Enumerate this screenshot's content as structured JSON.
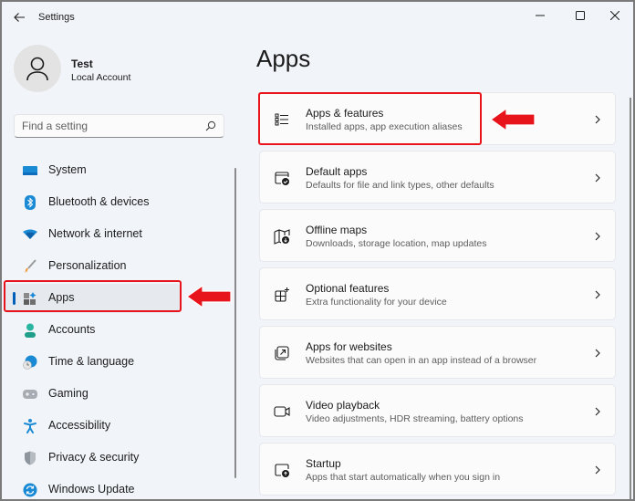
{
  "window": {
    "title": "Settings"
  },
  "profile": {
    "name": "Test",
    "account_type": "Local Account"
  },
  "search": {
    "placeholder": "Find a setting",
    "value": ""
  },
  "sidebar": {
    "selected": "Apps",
    "items": [
      {
        "label": "System",
        "icon": "system-icon"
      },
      {
        "label": "Bluetooth & devices",
        "icon": "bluetooth-icon"
      },
      {
        "label": "Network & internet",
        "icon": "wifi-icon"
      },
      {
        "label": "Personalization",
        "icon": "brush-icon"
      },
      {
        "label": "Apps",
        "icon": "apps-icon"
      },
      {
        "label": "Accounts",
        "icon": "person-icon"
      },
      {
        "label": "Time & language",
        "icon": "globe-clock-icon"
      },
      {
        "label": "Gaming",
        "icon": "gamepad-icon"
      },
      {
        "label": "Accessibility",
        "icon": "accessibility-icon"
      },
      {
        "label": "Privacy & security",
        "icon": "shield-icon"
      },
      {
        "label": "Windows Update",
        "icon": "update-icon"
      }
    ]
  },
  "main": {
    "title": "Apps",
    "cards": [
      {
        "title": "Apps & features",
        "subtitle": "Installed apps, app execution aliases",
        "icon": "list-icon"
      },
      {
        "title": "Default apps",
        "subtitle": "Defaults for file and link types, other defaults",
        "icon": "default-apps-icon"
      },
      {
        "title": "Offline maps",
        "subtitle": "Downloads, storage location, map updates",
        "icon": "map-download-icon"
      },
      {
        "title": "Optional features",
        "subtitle": "Extra functionality for your device",
        "icon": "add-grid-icon"
      },
      {
        "title": "Apps for websites",
        "subtitle": "Websites that can open in an app instead of a browser",
        "icon": "open-external-icon"
      },
      {
        "title": "Video playback",
        "subtitle": "Video adjustments, HDR streaming, battery options",
        "icon": "video-camera-icon"
      },
      {
        "title": "Startup",
        "subtitle": "Apps that start automatically when you sign in",
        "icon": "startup-icon"
      }
    ]
  },
  "annotations": {
    "highlight_color": "#e8141b",
    "highlighted": [
      "Apps",
      "Apps & features"
    ]
  },
  "colors": {
    "accent": "#005fb8",
    "background": "#f1f4f9",
    "card": "#fbfbfc"
  }
}
